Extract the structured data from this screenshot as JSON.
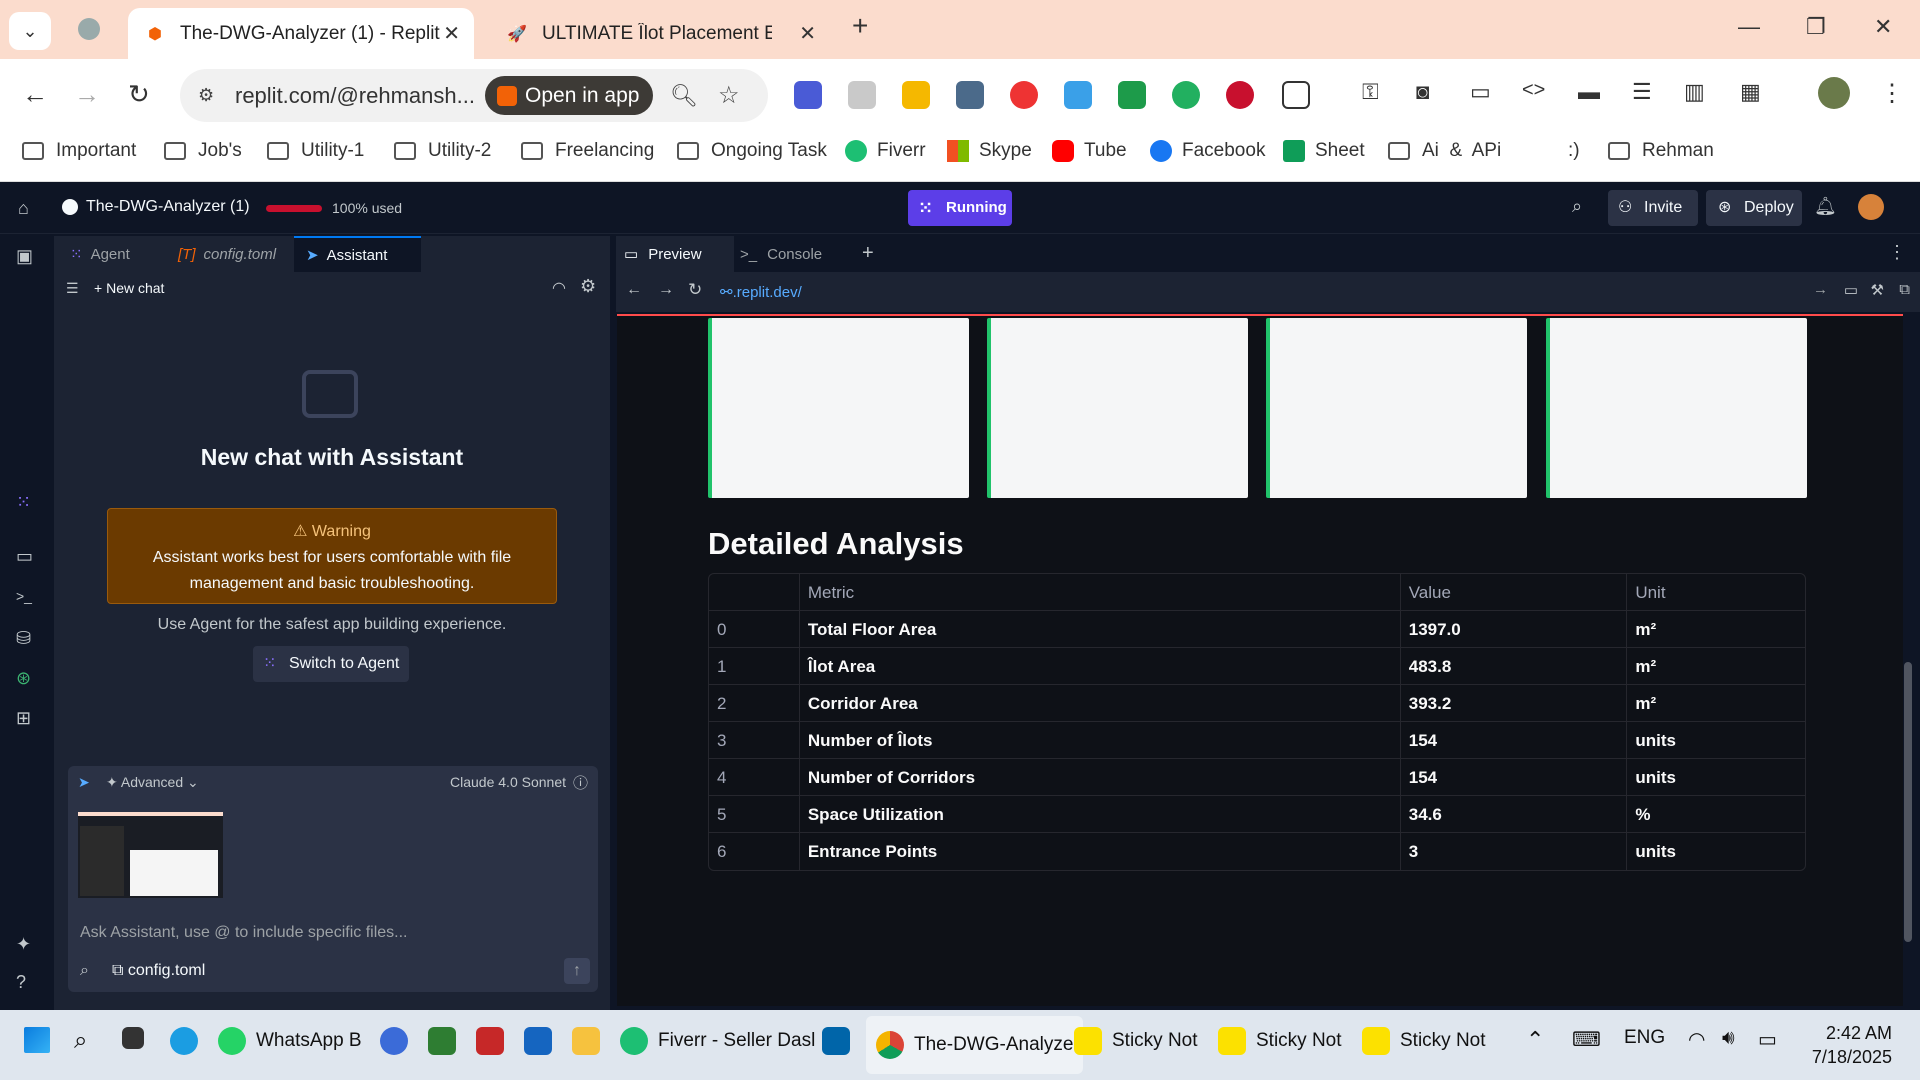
{
  "browser": {
    "tabs": [
      {
        "title": "The-DWG-Analyzer (1) - Replit",
        "active": true
      },
      {
        "title": "ULTIMATE Îlot Placement En",
        "active": false
      }
    ],
    "url": "replit.com/@rehmansh...",
    "open_in_app": "Open in app"
  },
  "bookmarks": [
    "Important",
    "Job's",
    "Utility-1",
    "Utility-2",
    "Freelancing",
    "Ongoing Task",
    "Fiverr",
    "Skype",
    "Tube",
    "Facebook",
    "Sheet",
    "Ai  &  APi",
    ":)",
    "Rehman"
  ],
  "replit": {
    "project": "The-DWG-Analyzer (1)",
    "usage": "100% used",
    "status": "Running",
    "invite": "Invite",
    "deploy": "Deploy",
    "left_tabs": [
      "Agent",
      "config.toml",
      "Assistant"
    ],
    "new_chat": "New chat",
    "chat_title": "New chat with Assistant",
    "warning_title": "Warning",
    "warning_text_1": "Assistant works best for users comfortable with file",
    "warning_text_2": "management and basic troubleshooting.",
    "warning_sub": "Use Agent for the safest app building experience.",
    "switch_agent": "Switch to Agent",
    "advanced": "Advanced",
    "model": "Claude 4.0 Sonnet",
    "input_placeholder": "Ask Assistant, use @ to include specific files...",
    "attached_file": "config.toml",
    "right_tabs": [
      "Preview",
      "Console"
    ],
    "preview_url": ".replit.dev/"
  },
  "analysis": {
    "heading": "Detailed Analysis",
    "headers": [
      "",
      "Metric",
      "Value",
      "Unit"
    ],
    "rows": [
      [
        "0",
        "Total Floor Area",
        "1397.0",
        "m²"
      ],
      [
        "1",
        "Îlot Area",
        "483.8",
        "m²"
      ],
      [
        "2",
        "Corridor Area",
        "393.2",
        "m²"
      ],
      [
        "3",
        "Number of Îlots",
        "154",
        "units"
      ],
      [
        "4",
        "Number of Corridors",
        "154",
        "units"
      ],
      [
        "5",
        "Space Utilization",
        "34.6",
        "%"
      ],
      [
        "6",
        "Entrance Points",
        "3",
        "units"
      ]
    ]
  },
  "taskbar": {
    "items": [
      "WhatsApp B",
      "Fiverr - Seller Dasl",
      "The-DWG-Analyze",
      "Sticky Not",
      "Sticky Not",
      "Sticky Not"
    ],
    "lang": "ENG",
    "time": "2:42 AM",
    "date": "7/18/2025"
  },
  "colors": {
    "accent": "#0079f2",
    "running": "#5c3ee8",
    "warning": "#6b3a00"
  }
}
